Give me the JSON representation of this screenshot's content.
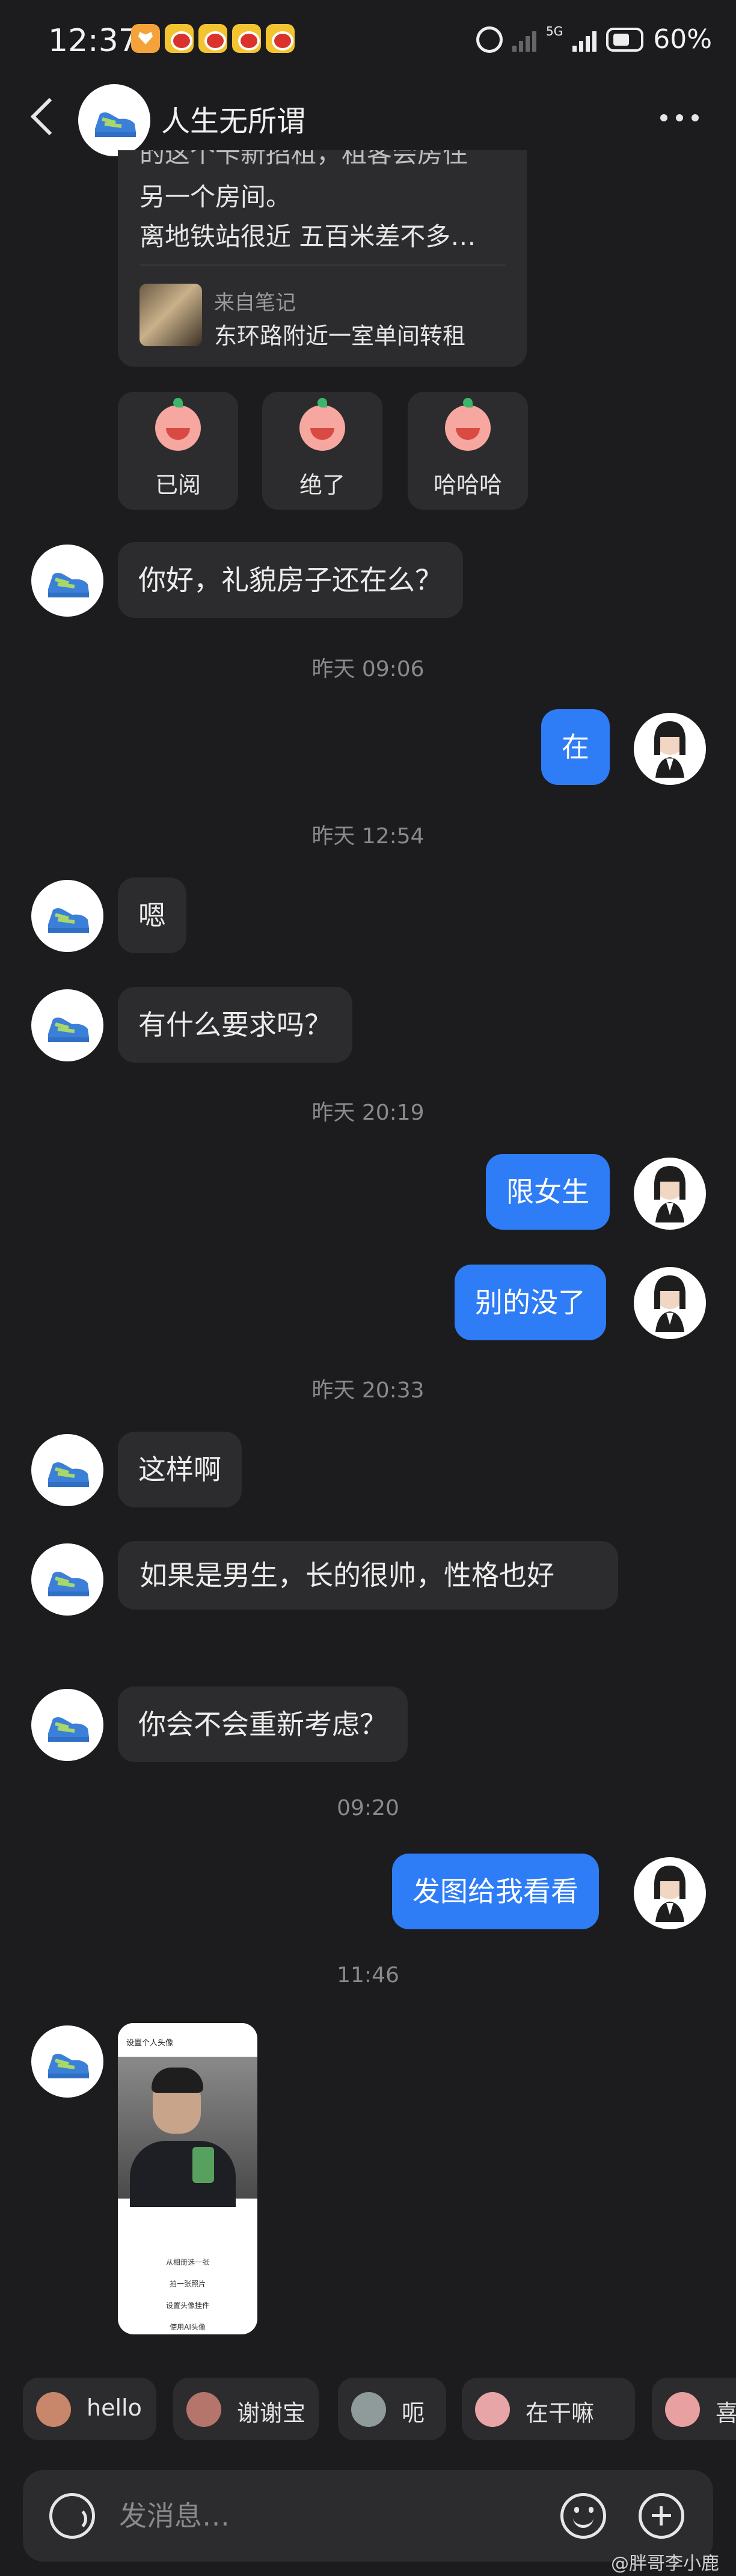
{
  "status_bar": {
    "time": "12:37",
    "network": "5G",
    "battery": "60%"
  },
  "header": {
    "title": "人生无所谓"
  },
  "shared_card": {
    "text_lines": [
      "的这个卡新招租，租客会房住",
      "另一个房间。",
      "离地铁站很近 五百米差不多…"
    ],
    "source": "来自笔记",
    "title": "东环路附近一室单间转租"
  },
  "reactions": [
    {
      "label": "已阅"
    },
    {
      "label": "绝了"
    },
    {
      "label": "哈哈哈"
    }
  ],
  "messages": [
    {
      "side": "in",
      "text": "你好，礼貌房子还在么？"
    },
    {
      "type": "time",
      "text": "昨天 09:06"
    },
    {
      "side": "out",
      "text": "在"
    },
    {
      "type": "time",
      "text": "昨天 12:54"
    },
    {
      "side": "in",
      "text": "嗯"
    },
    {
      "side": "in",
      "text": "有什么要求吗？"
    },
    {
      "type": "time",
      "text": "昨天 20:19"
    },
    {
      "side": "out",
      "text": "限女生"
    },
    {
      "side": "out",
      "text": "别的没了"
    },
    {
      "type": "time",
      "text": "昨天 20:33"
    },
    {
      "side": "in",
      "text": "这样啊"
    },
    {
      "side": "in",
      "text": "如果是男生，长的很帅，性格也好"
    },
    {
      "side": "in",
      "text": "你会不会重新考虑？"
    },
    {
      "type": "time",
      "text": "09:20"
    },
    {
      "side": "out",
      "text": "发图给我看看"
    },
    {
      "type": "time",
      "text": "11:46"
    }
  ],
  "image_message": {
    "header": "设置个人头像",
    "menu": [
      "从相册选一张",
      "拍一张照片",
      "设置头像挂件",
      "使用AI头像"
    ]
  },
  "quick_replies": [
    {
      "label": "hello",
      "sticker_color": "#c8866a"
    },
    {
      "label": "谢谢宝",
      "sticker_color": "#b5756a"
    },
    {
      "label": "呃",
      "sticker_color": "#8f9a9a"
    },
    {
      "label": "在干嘛",
      "sticker_color": "#e7a5a8"
    },
    {
      "label": "喜欢",
      "sticker_color": "#e8a0a0"
    }
  ],
  "input": {
    "placeholder": "发消息…"
  },
  "watermark": "@胖哥李小鹿",
  "colors": {
    "background": "#1c1c1e",
    "incoming_bubble": "#2c2c2e",
    "outgoing_bubble": "#2e7cf6"
  }
}
